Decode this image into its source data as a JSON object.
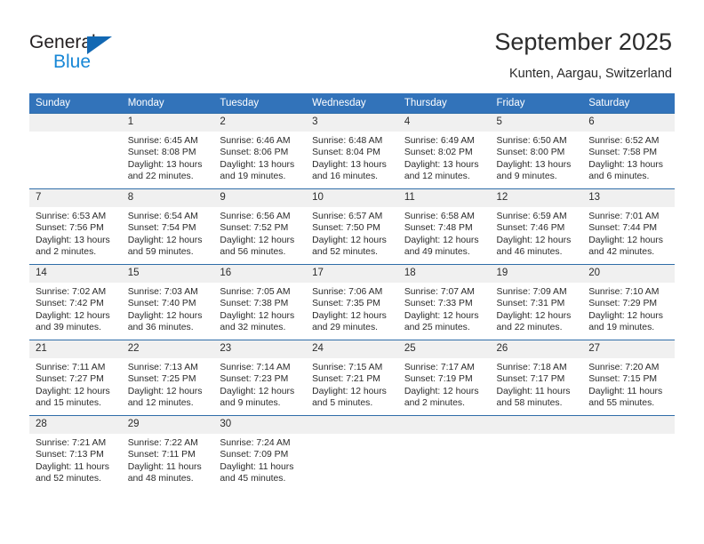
{
  "branding": {
    "name_dark": "General",
    "name_blue": "Blue",
    "triangle_color": "#1268b3",
    "blue_color": "#1787d6"
  },
  "header": {
    "title": "September 2025",
    "location": "Kunten, Aargau, Switzerland"
  },
  "theme": {
    "header_blue": "#3273ba",
    "row_divider_blue": "#2f6da8",
    "daynum_band": "#f0f0f0"
  },
  "weekday_headers": [
    "Sunday",
    "Monday",
    "Tuesday",
    "Wednesday",
    "Thursday",
    "Friday",
    "Saturday"
  ],
  "weeks": [
    [
      {
        "day": "",
        "sunrise": "",
        "sunset": "",
        "daylight": "",
        "empty": true
      },
      {
        "day": "1",
        "sunrise": "Sunrise: 6:45 AM",
        "sunset": "Sunset: 8:08 PM",
        "daylight": "Daylight: 13 hours and 22 minutes."
      },
      {
        "day": "2",
        "sunrise": "Sunrise: 6:46 AM",
        "sunset": "Sunset: 8:06 PM",
        "daylight": "Daylight: 13 hours and 19 minutes."
      },
      {
        "day": "3",
        "sunrise": "Sunrise: 6:48 AM",
        "sunset": "Sunset: 8:04 PM",
        "daylight": "Daylight: 13 hours and 16 minutes."
      },
      {
        "day": "4",
        "sunrise": "Sunrise: 6:49 AM",
        "sunset": "Sunset: 8:02 PM",
        "daylight": "Daylight: 13 hours and 12 minutes."
      },
      {
        "day": "5",
        "sunrise": "Sunrise: 6:50 AM",
        "sunset": "Sunset: 8:00 PM",
        "daylight": "Daylight: 13 hours and 9 minutes."
      },
      {
        "day": "6",
        "sunrise": "Sunrise: 6:52 AM",
        "sunset": "Sunset: 7:58 PM",
        "daylight": "Daylight: 13 hours and 6 minutes."
      }
    ],
    [
      {
        "day": "7",
        "sunrise": "Sunrise: 6:53 AM",
        "sunset": "Sunset: 7:56 PM",
        "daylight": "Daylight: 13 hours and 2 minutes."
      },
      {
        "day": "8",
        "sunrise": "Sunrise: 6:54 AM",
        "sunset": "Sunset: 7:54 PM",
        "daylight": "Daylight: 12 hours and 59 minutes."
      },
      {
        "day": "9",
        "sunrise": "Sunrise: 6:56 AM",
        "sunset": "Sunset: 7:52 PM",
        "daylight": "Daylight: 12 hours and 56 minutes."
      },
      {
        "day": "10",
        "sunrise": "Sunrise: 6:57 AM",
        "sunset": "Sunset: 7:50 PM",
        "daylight": "Daylight: 12 hours and 52 minutes."
      },
      {
        "day": "11",
        "sunrise": "Sunrise: 6:58 AM",
        "sunset": "Sunset: 7:48 PM",
        "daylight": "Daylight: 12 hours and 49 minutes."
      },
      {
        "day": "12",
        "sunrise": "Sunrise: 6:59 AM",
        "sunset": "Sunset: 7:46 PM",
        "daylight": "Daylight: 12 hours and 46 minutes."
      },
      {
        "day": "13",
        "sunrise": "Sunrise: 7:01 AM",
        "sunset": "Sunset: 7:44 PM",
        "daylight": "Daylight: 12 hours and 42 minutes."
      }
    ],
    [
      {
        "day": "14",
        "sunrise": "Sunrise: 7:02 AM",
        "sunset": "Sunset: 7:42 PM",
        "daylight": "Daylight: 12 hours and 39 minutes."
      },
      {
        "day": "15",
        "sunrise": "Sunrise: 7:03 AM",
        "sunset": "Sunset: 7:40 PM",
        "daylight": "Daylight: 12 hours and 36 minutes."
      },
      {
        "day": "16",
        "sunrise": "Sunrise: 7:05 AM",
        "sunset": "Sunset: 7:38 PM",
        "daylight": "Daylight: 12 hours and 32 minutes."
      },
      {
        "day": "17",
        "sunrise": "Sunrise: 7:06 AM",
        "sunset": "Sunset: 7:35 PM",
        "daylight": "Daylight: 12 hours and 29 minutes."
      },
      {
        "day": "18",
        "sunrise": "Sunrise: 7:07 AM",
        "sunset": "Sunset: 7:33 PM",
        "daylight": "Daylight: 12 hours and 25 minutes."
      },
      {
        "day": "19",
        "sunrise": "Sunrise: 7:09 AM",
        "sunset": "Sunset: 7:31 PM",
        "daylight": "Daylight: 12 hours and 22 minutes."
      },
      {
        "day": "20",
        "sunrise": "Sunrise: 7:10 AM",
        "sunset": "Sunset: 7:29 PM",
        "daylight": "Daylight: 12 hours and 19 minutes."
      }
    ],
    [
      {
        "day": "21",
        "sunrise": "Sunrise: 7:11 AM",
        "sunset": "Sunset: 7:27 PM",
        "daylight": "Daylight: 12 hours and 15 minutes."
      },
      {
        "day": "22",
        "sunrise": "Sunrise: 7:13 AM",
        "sunset": "Sunset: 7:25 PM",
        "daylight": "Daylight: 12 hours and 12 minutes."
      },
      {
        "day": "23",
        "sunrise": "Sunrise: 7:14 AM",
        "sunset": "Sunset: 7:23 PM",
        "daylight": "Daylight: 12 hours and 9 minutes."
      },
      {
        "day": "24",
        "sunrise": "Sunrise: 7:15 AM",
        "sunset": "Sunset: 7:21 PM",
        "daylight": "Daylight: 12 hours and 5 minutes."
      },
      {
        "day": "25",
        "sunrise": "Sunrise: 7:17 AM",
        "sunset": "Sunset: 7:19 PM",
        "daylight": "Daylight: 12 hours and 2 minutes."
      },
      {
        "day": "26",
        "sunrise": "Sunrise: 7:18 AM",
        "sunset": "Sunset: 7:17 PM",
        "daylight": "Daylight: 11 hours and 58 minutes."
      },
      {
        "day": "27",
        "sunrise": "Sunrise: 7:20 AM",
        "sunset": "Sunset: 7:15 PM",
        "daylight": "Daylight: 11 hours and 55 minutes."
      }
    ],
    [
      {
        "day": "28",
        "sunrise": "Sunrise: 7:21 AM",
        "sunset": "Sunset: 7:13 PM",
        "daylight": "Daylight: 11 hours and 52 minutes."
      },
      {
        "day": "29",
        "sunrise": "Sunrise: 7:22 AM",
        "sunset": "Sunset: 7:11 PM",
        "daylight": "Daylight: 11 hours and 48 minutes."
      },
      {
        "day": "30",
        "sunrise": "Sunrise: 7:24 AM",
        "sunset": "Sunset: 7:09 PM",
        "daylight": "Daylight: 11 hours and 45 minutes."
      },
      {
        "day": "",
        "sunrise": "",
        "sunset": "",
        "daylight": "",
        "empty": true
      },
      {
        "day": "",
        "sunrise": "",
        "sunset": "",
        "daylight": "",
        "empty": true
      },
      {
        "day": "",
        "sunrise": "",
        "sunset": "",
        "daylight": "",
        "empty": true
      },
      {
        "day": "",
        "sunrise": "",
        "sunset": "",
        "daylight": "",
        "empty": true
      }
    ]
  ]
}
